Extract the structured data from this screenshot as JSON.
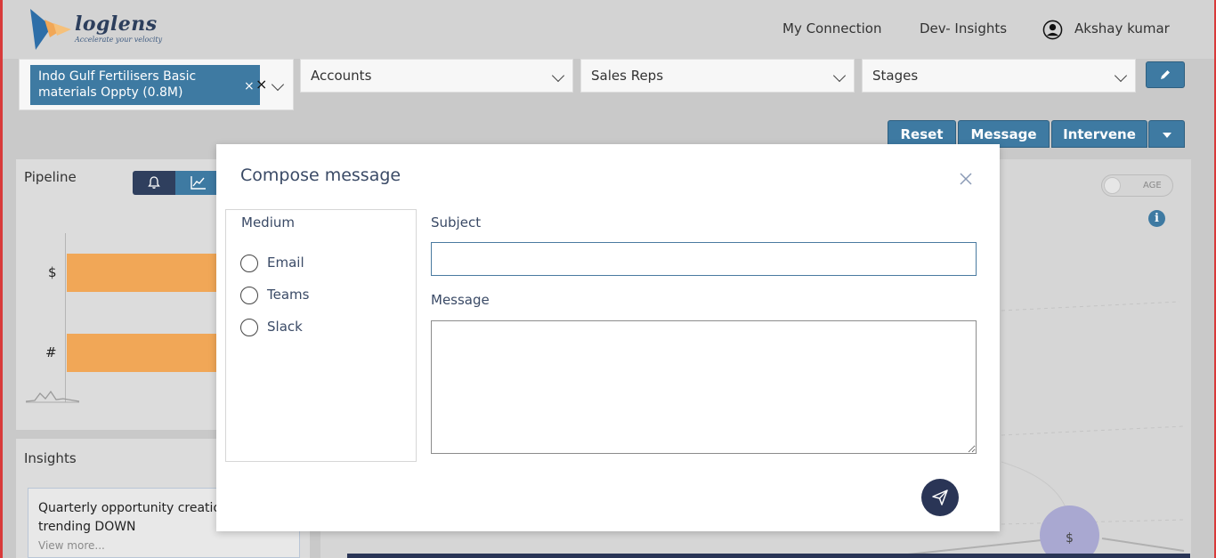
{
  "header": {
    "logo_text": "loglens",
    "logo_tagline": "Accelerate your velocity",
    "nav": [
      "My Connection",
      "Dev- Insights"
    ],
    "user_name": "Akshay kumar"
  },
  "filters": {
    "opportunity_tag": "Indo Gulf Fertilisers Basic materials Oppty (0.8M)",
    "tag_remove": "×",
    "clear_all": "×",
    "accounts": "Accounts",
    "sales_reps": "Sales Reps",
    "stages": "Stages"
  },
  "actions": {
    "reset": "Reset",
    "message": "Message",
    "intervene": "Intervene"
  },
  "pipeline": {
    "title": "Pipeline",
    "bar_labels": [
      "$",
      "#"
    ]
  },
  "insights": {
    "title": "Insights",
    "card_text": "Quarterly opportunity creation is trending DOWN",
    "view_more": "View more..."
  },
  "right_panel": {
    "age_toggle": "AGE",
    "node_label": "$"
  },
  "modal": {
    "title": "Compose message",
    "medium_title": "Medium",
    "mediums": [
      "Email",
      "Teams",
      "Slack"
    ],
    "subject_label": "Subject",
    "subject_value": "",
    "message_label": "Message",
    "message_value": ""
  },
  "colors": {
    "primary": "#3e7aa2",
    "dark_navy": "#2a3556",
    "bar": "#f1a757",
    "frame": "#d83a3a"
  }
}
